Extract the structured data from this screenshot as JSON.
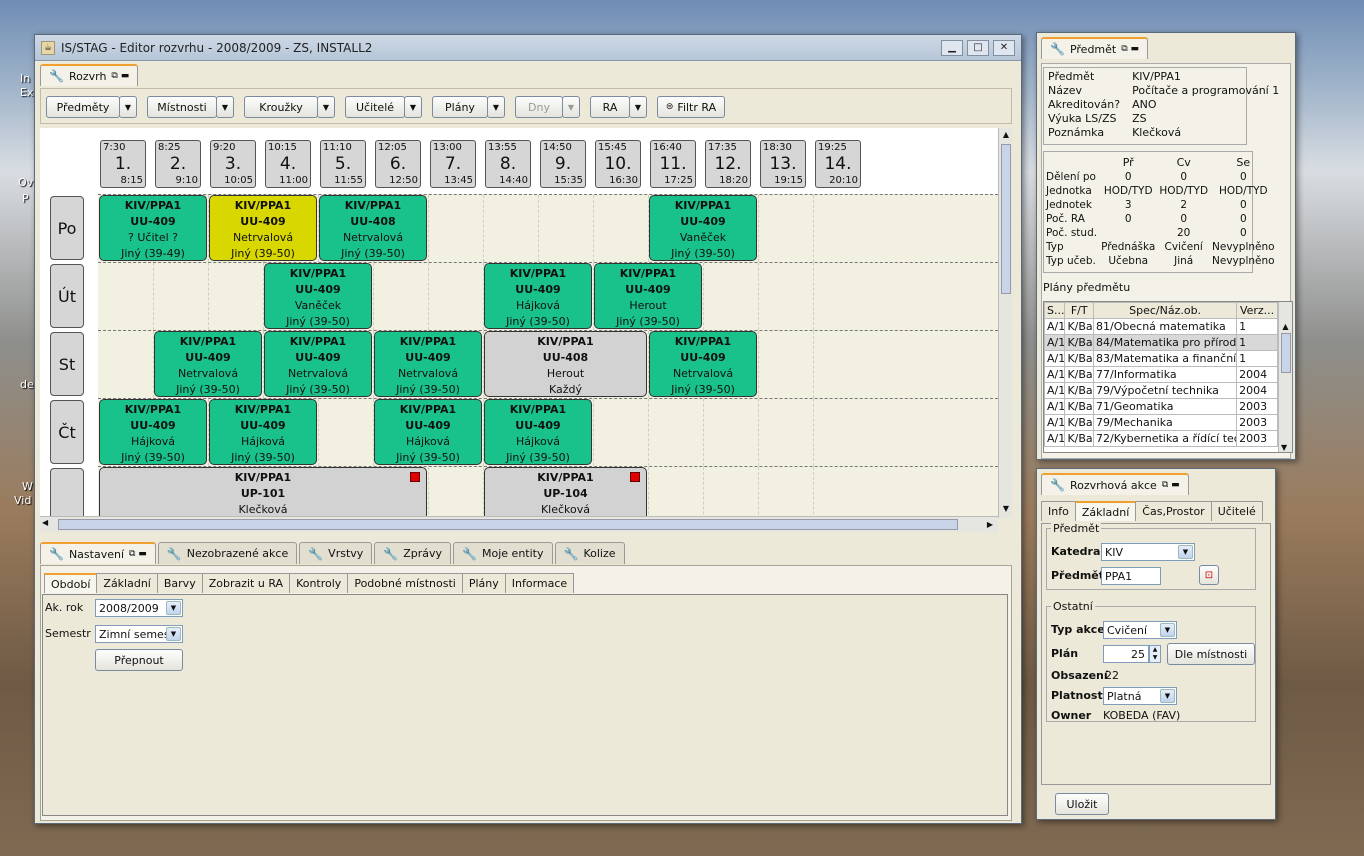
{
  "desktop": {
    "labels": [
      "In",
      "Ex",
      "Ov",
      "P",
      "de",
      "W",
      "Vid"
    ]
  },
  "main_window": {
    "title": "IS/STAG - Editor rozvrhu - 2008/2009 - ZS,  INSTALL2"
  },
  "rozvrh_tab": {
    "label": "Rozvrh"
  },
  "toolbar": {
    "predmety": "Předměty",
    "mistnosti": "Místnosti",
    "krouzky": "Kroužky",
    "ucitele": "Učitelé",
    "plany": "Plány",
    "dny": "Dny",
    "ra": "RA",
    "filtr": "Filtr RA"
  },
  "slots": [
    {
      "start": "7:30",
      "num": "1.",
      "end": "8:15"
    },
    {
      "start": "8:25",
      "num": "2.",
      "end": "9:10"
    },
    {
      "start": "9:20",
      "num": "3.",
      "end": "10:05"
    },
    {
      "start": "10:15",
      "num": "4.",
      "end": "11:00"
    },
    {
      "start": "11:10",
      "num": "5.",
      "end": "11:55"
    },
    {
      "start": "12:05",
      "num": "6.",
      "end": "12:50"
    },
    {
      "start": "13:00",
      "num": "7.",
      "end": "13:45"
    },
    {
      "start": "13:55",
      "num": "8.",
      "end": "14:40"
    },
    {
      "start": "14:50",
      "num": "9.",
      "end": "15:35"
    },
    {
      "start": "15:45",
      "num": "10.",
      "end": "16:30"
    },
    {
      "start": "16:40",
      "num": "11.",
      "end": "17:25"
    },
    {
      "start": "17:35",
      "num": "12.",
      "end": "18:20"
    },
    {
      "start": "18:30",
      "num": "13.",
      "end": "19:15"
    },
    {
      "start": "19:25",
      "num": "14.",
      "end": "20:10"
    }
  ],
  "days": [
    "Po",
    "Út",
    "St",
    "Čt",
    ""
  ],
  "events": [
    {
      "day": 0,
      "slot": 0,
      "len": 2,
      "color": "green",
      "l1": "KIV/PPA1",
      "l2": "UU-409",
      "l3": "? Učitel ?",
      "l4": "Jiný (39-49)"
    },
    {
      "day": 0,
      "slot": 2,
      "len": 2,
      "color": "yellow",
      "l1": "KIV/PPA1",
      "l2": "UU-409",
      "l3": "Netrvalová",
      "l4": "Jiný (39-50)"
    },
    {
      "day": 0,
      "slot": 4,
      "len": 2,
      "color": "green",
      "l1": "KIV/PPA1",
      "l2": "UU-408",
      "l3": "Netrvalová",
      "l4": "Jiný (39-50)"
    },
    {
      "day": 0,
      "slot": 10,
      "len": 2,
      "color": "green",
      "l1": "KIV/PPA1",
      "l2": "UU-409",
      "l3": "Vaněček",
      "l4": "Jiný (39-50)"
    },
    {
      "day": 1,
      "slot": 3,
      "len": 2,
      "color": "green",
      "l1": "KIV/PPA1",
      "l2": "UU-409",
      "l3": "Vaněček",
      "l4": "Jiný (39-50)"
    },
    {
      "day": 1,
      "slot": 7,
      "len": 2,
      "color": "green",
      "l1": "KIV/PPA1",
      "l2": "UU-409",
      "l3": "Hájková",
      "l4": "Jiný (39-50)"
    },
    {
      "day": 1,
      "slot": 9,
      "len": 2,
      "color": "green",
      "l1": "KIV/PPA1",
      "l2": "UU-409",
      "l3": "Herout",
      "l4": "Jiný (39-50)"
    },
    {
      "day": 2,
      "slot": 1,
      "len": 2,
      "color": "green",
      "l1": "KIV/PPA1",
      "l2": "UU-409",
      "l3": "Netrvalová",
      "l4": "Jiný (39-50)"
    },
    {
      "day": 2,
      "slot": 3,
      "len": 2,
      "color": "green",
      "l1": "KIV/PPA1",
      "l2": "UU-409",
      "l3": "Netrvalová",
      "l4": "Jiný (39-50)"
    },
    {
      "day": 2,
      "slot": 5,
      "len": 2,
      "color": "green",
      "l1": "KIV/PPA1",
      "l2": "UU-409",
      "l3": "Netrvalová",
      "l4": "Jiný (39-50)"
    },
    {
      "day": 2,
      "slot": 7,
      "len": 3,
      "color": "grey",
      "l1": "KIV/PPA1",
      "l2": "UU-408",
      "l3": "Herout",
      "l4": "Každý"
    },
    {
      "day": 2,
      "slot": 10,
      "len": 2,
      "color": "green",
      "l1": "KIV/PPA1",
      "l2": "UU-409",
      "l3": "Netrvalová",
      "l4": "Jiný (39-50)"
    },
    {
      "day": 3,
      "slot": 0,
      "len": 2,
      "color": "green",
      "l1": "KIV/PPA1",
      "l2": "UU-409",
      "l3": "Hájková",
      "l4": "Jiný (39-50)"
    },
    {
      "day": 3,
      "slot": 2,
      "len": 2,
      "color": "green",
      "l1": "KIV/PPA1",
      "l2": "UU-409",
      "l3": "Hájková",
      "l4": "Jiný (39-50)"
    },
    {
      "day": 3,
      "slot": 5,
      "len": 2,
      "color": "green",
      "l1": "KIV/PPA1",
      "l2": "UU-409",
      "l3": "Hájková",
      "l4": "Jiný (39-50)"
    },
    {
      "day": 3,
      "slot": 7,
      "len": 2,
      "color": "green",
      "l1": "KIV/PPA1",
      "l2": "UU-409",
      "l3": "Hájková",
      "l4": "Jiný (39-50)"
    },
    {
      "day": 4,
      "slot": 0,
      "len": 6,
      "color": "grey",
      "red": true,
      "l1": "KIV/PPA1",
      "l2": "UP-101",
      "l3": "Klečková",
      "l4": ""
    },
    {
      "day": 4,
      "slot": 7,
      "len": 3,
      "color": "grey",
      "red": true,
      "l1": "KIV/PPA1",
      "l2": "UP-104",
      "l3": "Klečková",
      "l4": ""
    }
  ],
  "bottom_tabs": [
    "Nastavení",
    "Nezobrazené akce",
    "Vrstvy",
    "Zprávy",
    "Moje entity",
    "Kolize"
  ],
  "sub_tabs": [
    "Období",
    "Základní",
    "Barvy",
    "Zobrazit u RA",
    "Kontroly",
    "Podobné místnosti",
    "Plány",
    "Informace"
  ],
  "obdobi": {
    "akrok_label": "Ak. rok",
    "akrok_value": "2008/2009",
    "semestr_label": "Semestr",
    "semestr_value": "Zimní semestr",
    "prepnout": "Přepnout"
  },
  "predmet_panel": {
    "tab": "Předmět",
    "info": [
      [
        "Předmět",
        "KIV/PPA1"
      ],
      [
        "Název",
        "Počítače a programování 1"
      ],
      [
        "Akreditován?",
        "ANO"
      ],
      [
        "Výuka LS/ZS",
        "ZS"
      ],
      [
        "Poznámka",
        "Klečková"
      ]
    ],
    "cols": [
      "",
      "Př",
      "Cv",
      "Se"
    ],
    "rows": [
      [
        "Dělení po",
        "0",
        "0",
        "0"
      ],
      [
        "Jednotka",
        "HOD/TYD",
        "HOD/TYD",
        "HOD/TYD"
      ],
      [
        "Jednotek",
        "3",
        "2",
        "0"
      ],
      [
        "Poč. RA",
        "0",
        "0",
        "0"
      ],
      [
        "Poč. stud.",
        "",
        "20",
        "0"
      ],
      [
        "Typ",
        "Přednáška",
        "Cvičení",
        "Nevyplněno"
      ],
      [
        "Typ učeb.",
        "Učebna",
        "Jiná",
        "Nevyplněno"
      ]
    ],
    "plany_label": "Plány předmětu",
    "plany_cols": [
      "S...",
      "F/T",
      "Spec/Náz.ob.",
      "Verz..."
    ],
    "plany_rows": [
      [
        "A/1",
        "K/Bak",
        "81/Obecná matematika",
        "1"
      ],
      [
        "A/1",
        "K/Bak",
        "84/Matematika pro přírod...",
        "1"
      ],
      [
        "A/1",
        "K/Bak",
        "83/Matematika a finanční ...",
        "1"
      ],
      [
        "A/1",
        "K/Bak",
        "77/Informatika",
        "2004"
      ],
      [
        "A/1",
        "K/Bak",
        "79/Výpočetní technika",
        "2004"
      ],
      [
        "A/1",
        "K/Bak",
        "71/Geomatika",
        "2003"
      ],
      [
        "A/1",
        "K/Bak",
        "79/Mechanika",
        "2003"
      ],
      [
        "A/1",
        "K/Bak",
        "72/Kybernetika a řídící tec...",
        "2003"
      ]
    ]
  },
  "akce_panel": {
    "tab": "Rozvrhová akce",
    "subtabs": [
      "Info",
      "Základní",
      "Čas,Prostor",
      "Učitelé"
    ],
    "predmet_group": "Předmět",
    "katedra_label": "Katedra",
    "katedra_value": "KIV",
    "predmet_label": "Předmět",
    "predmet_value": "PPA1",
    "ostatni_group": "Ostatní",
    "typakce_label": "Typ akce",
    "typakce_value": "Cvičení",
    "plan_label": "Plán",
    "plan_value": "25",
    "dle_mistnosti": "Dle místnosti",
    "obsazeni_label": "Obsazení",
    "obsazeni_value": "22",
    "platnost_label": "Platnost",
    "platnost_value": "Platná",
    "owner_label": "Owner",
    "owner_value": "KOBEDA (FAV)",
    "ulozit": "Uložit"
  }
}
